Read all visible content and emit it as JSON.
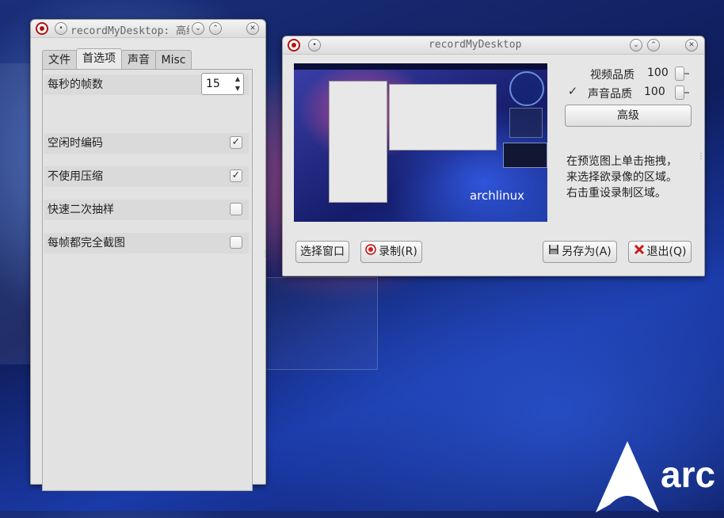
{
  "prefs_window": {
    "title": "recordMyDesktop: 高级",
    "tabs": [
      {
        "label": "文件"
      },
      {
        "label": "首选项"
      },
      {
        "label": "声音"
      },
      {
        "label": "Misc"
      }
    ],
    "fps_label": "每秒的帧数",
    "fps_value": "15",
    "options": [
      {
        "label": "空闲时编码",
        "checked": true
      },
      {
        "label": "不使用压缩",
        "checked": true
      },
      {
        "label": "快速二次抽样",
        "checked": false
      },
      {
        "label": "每帧都完全截图",
        "checked": false
      }
    ]
  },
  "main_window": {
    "title": "recordMyDesktop",
    "preview_logo_text": "archlinux",
    "video_quality_label": "视频品质",
    "video_quality_value": "100",
    "audio_quality_label": "声音品质",
    "audio_quality_value": "100",
    "audio_enabled": true,
    "advanced_button": "高级",
    "hint_lines": [
      "在预览图上单击拖拽，",
      "来选择欲录像的区域。",
      "右击重设录制区域。"
    ],
    "select_window_button": "选择窗口",
    "record_button": "录制(R)",
    "save_as_button": "另存为(A)",
    "quit_button": "退出(Q)"
  },
  "desktop": {
    "logo_text": "arc"
  },
  "colors": {
    "record_red": "#d81e1e",
    "quit_red": "#c81818",
    "desktop_blue": "#1a3aa8"
  }
}
